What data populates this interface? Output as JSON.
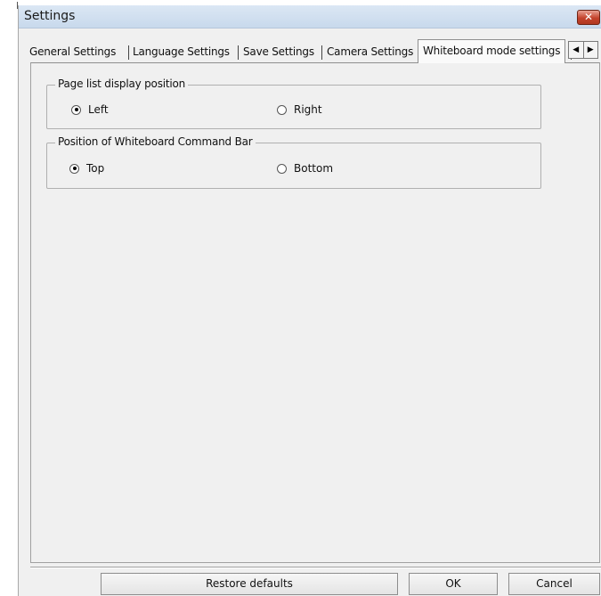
{
  "window": {
    "title": "Settings",
    "close_label": "✕"
  },
  "tabs": [
    {
      "label": "General Settings",
      "active": false
    },
    {
      "label": "Language Settings",
      "active": false
    },
    {
      "label": "Save Settings",
      "active": false
    },
    {
      "label": "Camera Settings",
      "active": false
    },
    {
      "label": "Whiteboard mode settings",
      "active": true
    }
  ],
  "tab_scroll": {
    "left_icon": "◀",
    "right_icon": "▶"
  },
  "groups": {
    "page_list": {
      "title": "Page list display position",
      "options": [
        {
          "label": "Left",
          "checked": true
        },
        {
          "label": "Right",
          "checked": false
        }
      ]
    },
    "command_bar": {
      "title": "Position of Whiteboard Command Bar",
      "options": [
        {
          "label": "Top",
          "checked": true
        },
        {
          "label": "Bottom",
          "checked": false
        }
      ]
    }
  },
  "buttons": {
    "restore": "Restore defaults",
    "ok": "OK",
    "cancel": "Cancel"
  }
}
